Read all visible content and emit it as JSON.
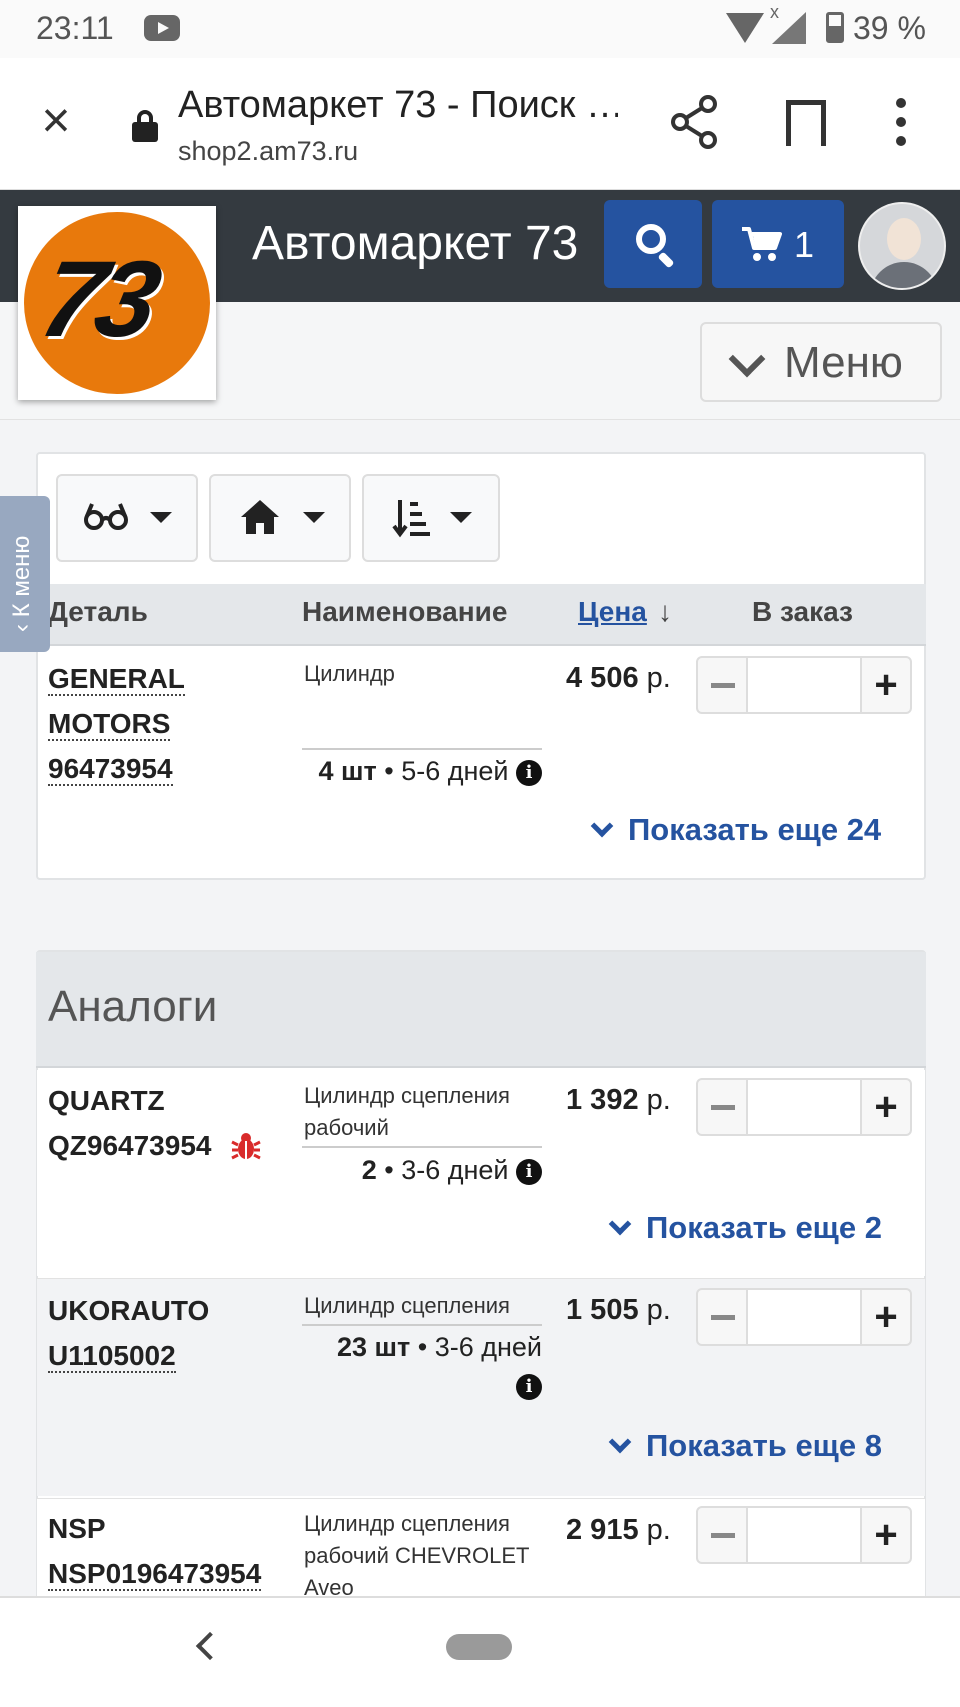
{
  "status_bar": {
    "time": "23:11",
    "battery": "39 %"
  },
  "browser": {
    "title": "Автомаркет 73 - Поиск …",
    "url": "shop2.am73.ru"
  },
  "site": {
    "logo_text": "73",
    "brand": "Автомаркет 73",
    "cart_count": "1",
    "menu_label": "Меню",
    "side_tab": "К меню"
  },
  "table": {
    "headers": {
      "part": "Деталь",
      "name": "Наименование",
      "price": "Цена",
      "price_sort": "↓",
      "order": "В заказ"
    }
  },
  "main_item": {
    "brand": "GENERAL",
    "brand2": "MOTORS",
    "number": "96473954",
    "name": "Цилиндр",
    "stock_qty": "4 шт",
    "stock_days": " • 5-6 дней",
    "price": "4 506",
    "currency": " р.",
    "more": "Показать еще 24"
  },
  "analogs": {
    "title": "Аналоги",
    "items": [
      {
        "brand": "QUARTZ",
        "number": "QZ96473954",
        "name": "Цилиндр сцепления рабочий",
        "stock_qty": "2",
        "stock_days": " • 3-6 дней",
        "price": "1 392",
        "currency": " р.",
        "more": "Показать еще 2"
      },
      {
        "brand": "UKORAUTO",
        "number": "U1105002",
        "name": "Цилиндр сцепления",
        "stock_qty": "23 шт",
        "stock_days": " • 3-6 дней",
        "price": "1 505",
        "currency": " р.",
        "more": "Показать еще 8"
      },
      {
        "brand": "NSP",
        "number": "NSP0196473954",
        "name": "Цилиндр сцепления рабочий CHEVROLET Aveo",
        "price": "2 915",
        "currency": " р."
      }
    ]
  },
  "colors": {
    "header": "#343a40",
    "accent": "#2553a0",
    "logo": "#e8790c",
    "side_tab": "#98a8c0"
  },
  "icons": [
    "close-icon",
    "lock-icon",
    "share-icon",
    "bookmark-icon",
    "more-icon",
    "search-icon",
    "cart-icon",
    "avatar",
    "chevron-down-icon",
    "glasses-icon",
    "home-icon",
    "sort-icon",
    "info-icon",
    "bug-icon",
    "minus-icon",
    "plus-icon"
  ]
}
